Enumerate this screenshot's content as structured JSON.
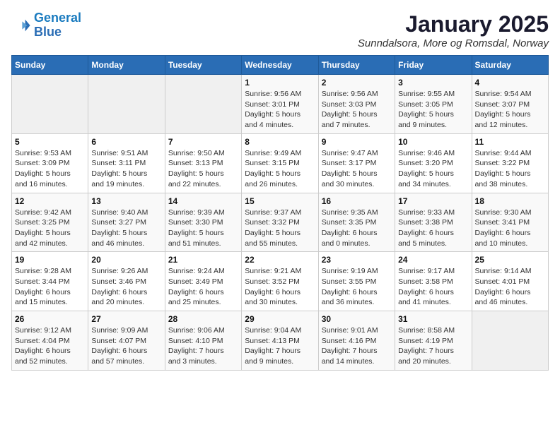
{
  "logo": {
    "line1": "General",
    "line2": "Blue"
  },
  "title": "January 2025",
  "subtitle": "Sunndalsora, More og Romsdal, Norway",
  "weekdays": [
    "Sunday",
    "Monday",
    "Tuesday",
    "Wednesday",
    "Thursday",
    "Friday",
    "Saturday"
  ],
  "weeks": [
    [
      {
        "day": "",
        "info": ""
      },
      {
        "day": "",
        "info": ""
      },
      {
        "day": "",
        "info": ""
      },
      {
        "day": "1",
        "info": "Sunrise: 9:56 AM\nSunset: 3:01 PM\nDaylight: 5 hours\nand 4 minutes."
      },
      {
        "day": "2",
        "info": "Sunrise: 9:56 AM\nSunset: 3:03 PM\nDaylight: 5 hours\nand 7 minutes."
      },
      {
        "day": "3",
        "info": "Sunrise: 9:55 AM\nSunset: 3:05 PM\nDaylight: 5 hours\nand 9 minutes."
      },
      {
        "day": "4",
        "info": "Sunrise: 9:54 AM\nSunset: 3:07 PM\nDaylight: 5 hours\nand 12 minutes."
      }
    ],
    [
      {
        "day": "5",
        "info": "Sunrise: 9:53 AM\nSunset: 3:09 PM\nDaylight: 5 hours\nand 16 minutes."
      },
      {
        "day": "6",
        "info": "Sunrise: 9:51 AM\nSunset: 3:11 PM\nDaylight: 5 hours\nand 19 minutes."
      },
      {
        "day": "7",
        "info": "Sunrise: 9:50 AM\nSunset: 3:13 PM\nDaylight: 5 hours\nand 22 minutes."
      },
      {
        "day": "8",
        "info": "Sunrise: 9:49 AM\nSunset: 3:15 PM\nDaylight: 5 hours\nand 26 minutes."
      },
      {
        "day": "9",
        "info": "Sunrise: 9:47 AM\nSunset: 3:17 PM\nDaylight: 5 hours\nand 30 minutes."
      },
      {
        "day": "10",
        "info": "Sunrise: 9:46 AM\nSunset: 3:20 PM\nDaylight: 5 hours\nand 34 minutes."
      },
      {
        "day": "11",
        "info": "Sunrise: 9:44 AM\nSunset: 3:22 PM\nDaylight: 5 hours\nand 38 minutes."
      }
    ],
    [
      {
        "day": "12",
        "info": "Sunrise: 9:42 AM\nSunset: 3:25 PM\nDaylight: 5 hours\nand 42 minutes."
      },
      {
        "day": "13",
        "info": "Sunrise: 9:40 AM\nSunset: 3:27 PM\nDaylight: 5 hours\nand 46 minutes."
      },
      {
        "day": "14",
        "info": "Sunrise: 9:39 AM\nSunset: 3:30 PM\nDaylight: 5 hours\nand 51 minutes."
      },
      {
        "day": "15",
        "info": "Sunrise: 9:37 AM\nSunset: 3:32 PM\nDaylight: 5 hours\nand 55 minutes."
      },
      {
        "day": "16",
        "info": "Sunrise: 9:35 AM\nSunset: 3:35 PM\nDaylight: 6 hours\nand 0 minutes."
      },
      {
        "day": "17",
        "info": "Sunrise: 9:33 AM\nSunset: 3:38 PM\nDaylight: 6 hours\nand 5 minutes."
      },
      {
        "day": "18",
        "info": "Sunrise: 9:30 AM\nSunset: 3:41 PM\nDaylight: 6 hours\nand 10 minutes."
      }
    ],
    [
      {
        "day": "19",
        "info": "Sunrise: 9:28 AM\nSunset: 3:44 PM\nDaylight: 6 hours\nand 15 minutes."
      },
      {
        "day": "20",
        "info": "Sunrise: 9:26 AM\nSunset: 3:46 PM\nDaylight: 6 hours\nand 20 minutes."
      },
      {
        "day": "21",
        "info": "Sunrise: 9:24 AM\nSunset: 3:49 PM\nDaylight: 6 hours\nand 25 minutes."
      },
      {
        "day": "22",
        "info": "Sunrise: 9:21 AM\nSunset: 3:52 PM\nDaylight: 6 hours\nand 30 minutes."
      },
      {
        "day": "23",
        "info": "Sunrise: 9:19 AM\nSunset: 3:55 PM\nDaylight: 6 hours\nand 36 minutes."
      },
      {
        "day": "24",
        "info": "Sunrise: 9:17 AM\nSunset: 3:58 PM\nDaylight: 6 hours\nand 41 minutes."
      },
      {
        "day": "25",
        "info": "Sunrise: 9:14 AM\nSunset: 4:01 PM\nDaylight: 6 hours\nand 46 minutes."
      }
    ],
    [
      {
        "day": "26",
        "info": "Sunrise: 9:12 AM\nSunset: 4:04 PM\nDaylight: 6 hours\nand 52 minutes."
      },
      {
        "day": "27",
        "info": "Sunrise: 9:09 AM\nSunset: 4:07 PM\nDaylight: 6 hours\nand 57 minutes."
      },
      {
        "day": "28",
        "info": "Sunrise: 9:06 AM\nSunset: 4:10 PM\nDaylight: 7 hours\nand 3 minutes."
      },
      {
        "day": "29",
        "info": "Sunrise: 9:04 AM\nSunset: 4:13 PM\nDaylight: 7 hours\nand 9 minutes."
      },
      {
        "day": "30",
        "info": "Sunrise: 9:01 AM\nSunset: 4:16 PM\nDaylight: 7 hours\nand 14 minutes."
      },
      {
        "day": "31",
        "info": "Sunrise: 8:58 AM\nSunset: 4:19 PM\nDaylight: 7 hours\nand 20 minutes."
      },
      {
        "day": "",
        "info": ""
      }
    ]
  ]
}
